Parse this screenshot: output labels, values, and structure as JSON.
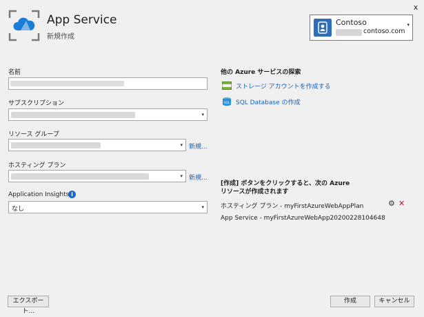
{
  "header": {
    "title": "App Service",
    "subtitle": "新規作成",
    "close_glyph": "x",
    "icon": "app-service-icon"
  },
  "account": {
    "name": "Contoso",
    "email": "contoso.com",
    "caret": "▾"
  },
  "form": {
    "name_label": "名前",
    "name_value": "",
    "subscription_label": "サブスクリプション",
    "resource_group_label": "リソース グループ",
    "hosting_plan_label": "ホスティング プラン",
    "new_link": "新規...",
    "insights_label": "Application Insights",
    "insights_info": "i",
    "insights_value": "なし",
    "dropdown_arrow": "▾"
  },
  "explore": {
    "title": "他の Azure サービスの探索",
    "links": [
      {
        "label": "ストレージ アカウントを作成する",
        "icon": "storage-icon"
      },
      {
        "label": "SQL Database の作成",
        "icon": "sql-icon"
      }
    ]
  },
  "resources": {
    "intro_line1": "[作成] ボタンをクリックすると、次の Azure",
    "intro_line2": "リソースが作成されます",
    "items": [
      {
        "label": "ホスティング プラン - myFirstAzureWebAppPlan"
      },
      {
        "label": "App Service - myFirstAzureWebApp20200228104648"
      }
    ],
    "gear_glyph": "⚙",
    "delete_glyph": "✕"
  },
  "footer": {
    "export_label": "エクスポート...",
    "create_label": "作成",
    "cancel_label": "キャンセル"
  },
  "colors": {
    "accent": "#1a5fb4",
    "delete": "#c8102e"
  }
}
